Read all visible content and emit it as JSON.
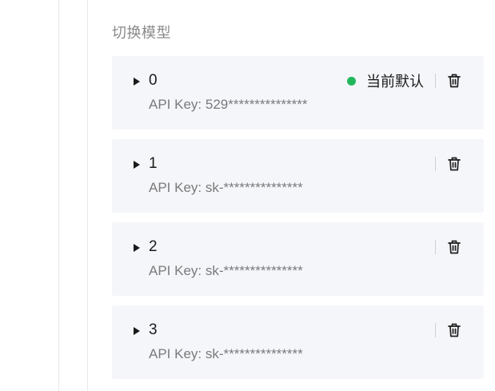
{
  "section": {
    "title": "切换模型"
  },
  "models": [
    {
      "name": "0",
      "api_key": "API Key: 529***************",
      "status": "当前默认",
      "status_color": "#21b85c"
    },
    {
      "name": "1",
      "api_key": "API Key: sk-***************"
    },
    {
      "name": "2",
      "api_key": "API Key: sk-***************"
    },
    {
      "name": "3",
      "api_key": "API Key: sk-***************"
    }
  ],
  "icons": {
    "expand": "caret-right-icon",
    "delete": "trash-icon",
    "status": "green-dot-icon"
  }
}
